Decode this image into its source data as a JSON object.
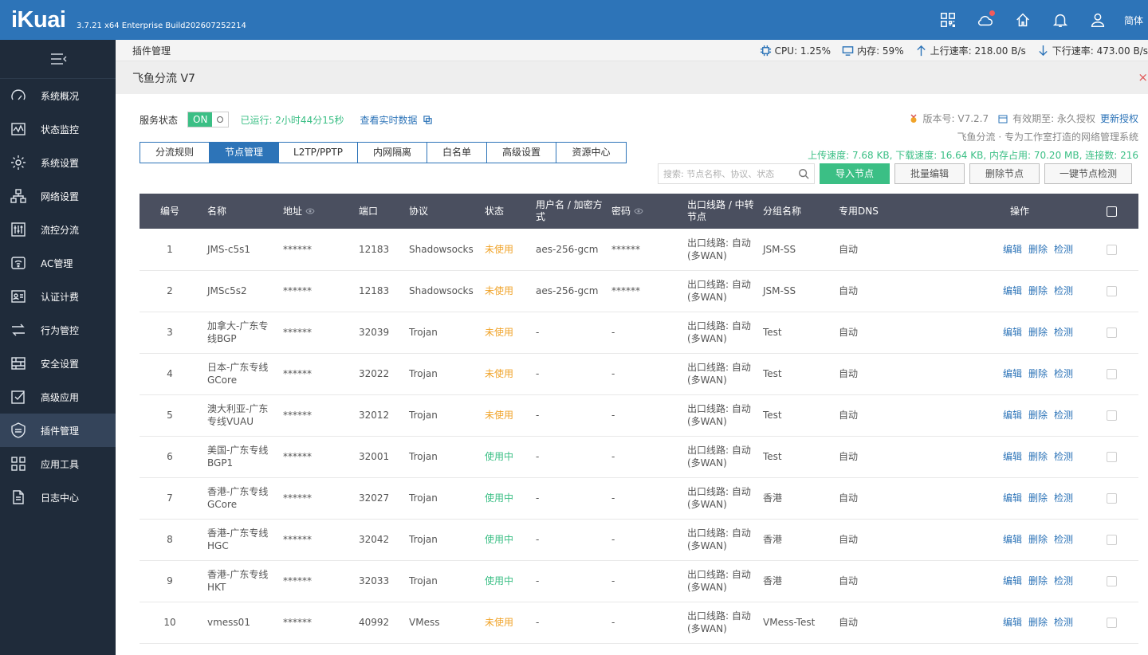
{
  "header": {
    "logo": "iKuai",
    "version": "3.7.21 x64 Enterprise Build202607252214",
    "lang": "简体",
    "icons": [
      "grid-icon",
      "cloud-icon",
      "home-icon",
      "bell-icon",
      "user-icon"
    ]
  },
  "sidebar": {
    "items": [
      {
        "label": "系统概况",
        "icon": "dashboard-icon"
      },
      {
        "label": "状态监控",
        "icon": "monitor-icon"
      },
      {
        "label": "系统设置",
        "icon": "gear-icon"
      },
      {
        "label": "网络设置",
        "icon": "network-icon"
      },
      {
        "label": "流控分流",
        "icon": "sliders-icon"
      },
      {
        "label": "AC管理",
        "icon": "wifi-icon"
      },
      {
        "label": "认证计费",
        "icon": "id-card-icon"
      },
      {
        "label": "行为管控",
        "icon": "arrows-icon"
      },
      {
        "label": "安全设置",
        "icon": "firewall-icon"
      },
      {
        "label": "高级应用",
        "icon": "check-square-icon"
      },
      {
        "label": "插件管理",
        "icon": "plugin-icon"
      },
      {
        "label": "应用工具",
        "icon": "apps-icon"
      },
      {
        "label": "日志中心",
        "icon": "document-icon"
      }
    ]
  },
  "breadcrumb": "插件管理",
  "stats": {
    "cpu": "CPU: 1.25%",
    "mem": "内存: 59%",
    "up": "上行速率: 218.00 B/s",
    "down": "下行速率: 473.00 B/s"
  },
  "plugin": {
    "title": "飞鱼分流 V7",
    "close": "×"
  },
  "service": {
    "label": "服务状态",
    "on": "ON",
    "running": "已运行: 2小时44分15秒",
    "realtime": "查看实时数据"
  },
  "info": {
    "version": "版本号: V7.2.7",
    "expire": "有效期至: 永久授权",
    "renew": "更新授权",
    "slogan": "飞鱼分流 · 专为工作室打造的网络管理系统",
    "traffic": "上传速度: 7.68 KB, 下载速度: 16.64 KB, 内存占用: 70.20 MB, 连接数: 216"
  },
  "tabs": [
    {
      "label": "分流规则",
      "active": false
    },
    {
      "label": "节点管理",
      "active": true
    },
    {
      "label": "L2TP/PPTP",
      "active": false
    },
    {
      "label": "内网隔离",
      "active": false
    },
    {
      "label": "白名单",
      "active": false
    },
    {
      "label": "高级设置",
      "active": false
    },
    {
      "label": "资源中心",
      "active": false
    }
  ],
  "toolbar": {
    "search_placeholder": "搜索: 节点名称、协议、状态",
    "import": "导入节点",
    "batch_edit": "批量编辑",
    "delete": "删除节点",
    "check": "一键节点检测"
  },
  "table": {
    "columns": [
      "编号",
      "名称",
      "地址",
      "端口",
      "协议",
      "状态",
      "用户名 / 加密方式",
      "密码",
      "出口线路 / 中转节点",
      "分组名称",
      "专用DNS",
      "操作"
    ],
    "actions": [
      "编辑",
      "删除",
      "检测"
    ],
    "rows": [
      {
        "no": "1",
        "name": "JMS-c5s1",
        "addr": "******",
        "port": "12183",
        "proto": "Shadowsocks",
        "status": "未使用",
        "used": false,
        "user": "aes-256-gcm",
        "pwd": "******",
        "exit": "出口线路: 自动(多WAN)",
        "group": "JSM-SS",
        "dns": "自动"
      },
      {
        "no": "2",
        "name": "JMSc5s2",
        "addr": "******",
        "port": "12183",
        "proto": "Shadowsocks",
        "status": "未使用",
        "used": false,
        "user": "aes-256-gcm",
        "pwd": "******",
        "exit": "出口线路: 自动(多WAN)",
        "group": "JSM-SS",
        "dns": "自动"
      },
      {
        "no": "3",
        "name": "加拿大-广东专线BGP",
        "addr": "******",
        "port": "32039",
        "proto": "Trojan",
        "status": "未使用",
        "used": false,
        "user": "-",
        "pwd": "-",
        "exit": "出口线路: 自动(多WAN)",
        "group": "Test",
        "dns": "自动"
      },
      {
        "no": "4",
        "name": "日本-广东专线GCore",
        "addr": "******",
        "port": "32022",
        "proto": "Trojan",
        "status": "未使用",
        "used": false,
        "user": "-",
        "pwd": "-",
        "exit": "出口线路: 自动(多WAN)",
        "group": "Test",
        "dns": "自动"
      },
      {
        "no": "5",
        "name": "澳大利亚-广东专线VUAU",
        "addr": "******",
        "port": "32012",
        "proto": "Trojan",
        "status": "未使用",
        "used": false,
        "user": "-",
        "pwd": "-",
        "exit": "出口线路: 自动(多WAN)",
        "group": "Test",
        "dns": "自动"
      },
      {
        "no": "6",
        "name": "美国-广东专线BGP1",
        "addr": "******",
        "port": "32001",
        "proto": "Trojan",
        "status": "使用中",
        "used": true,
        "user": "-",
        "pwd": "-",
        "exit": "出口线路: 自动(多WAN)",
        "group": "Test",
        "dns": "自动"
      },
      {
        "no": "7",
        "name": "香港-广东专线GCore",
        "addr": "******",
        "port": "32027",
        "proto": "Trojan",
        "status": "使用中",
        "used": true,
        "user": "-",
        "pwd": "-",
        "exit": "出口线路: 自动(多WAN)",
        "group": "香港",
        "dns": "自动"
      },
      {
        "no": "8",
        "name": "香港-广东专线HGC",
        "addr": "******",
        "port": "32042",
        "proto": "Trojan",
        "status": "使用中",
        "used": true,
        "user": "-",
        "pwd": "-",
        "exit": "出口线路: 自动(多WAN)",
        "group": "香港",
        "dns": "自动"
      },
      {
        "no": "9",
        "name": "香港-广东专线HKT",
        "addr": "******",
        "port": "32033",
        "proto": "Trojan",
        "status": "使用中",
        "used": true,
        "user": "-",
        "pwd": "-",
        "exit": "出口线路: 自动(多WAN)",
        "group": "香港",
        "dns": "自动"
      },
      {
        "no": "10",
        "name": "vmess01",
        "addr": "******",
        "port": "40992",
        "proto": "VMess",
        "status": "未使用",
        "used": false,
        "user": "-",
        "pwd": "-",
        "exit": "出口线路: 自动(多WAN)",
        "group": "VMess-Test",
        "dns": "自动"
      }
    ]
  },
  "colors": {
    "brand": "#2d74b8",
    "sidebar": "#1f2b3a",
    "success": "#3bbf85",
    "warning": "#f0a329",
    "table_header": "#4a4f5f"
  }
}
